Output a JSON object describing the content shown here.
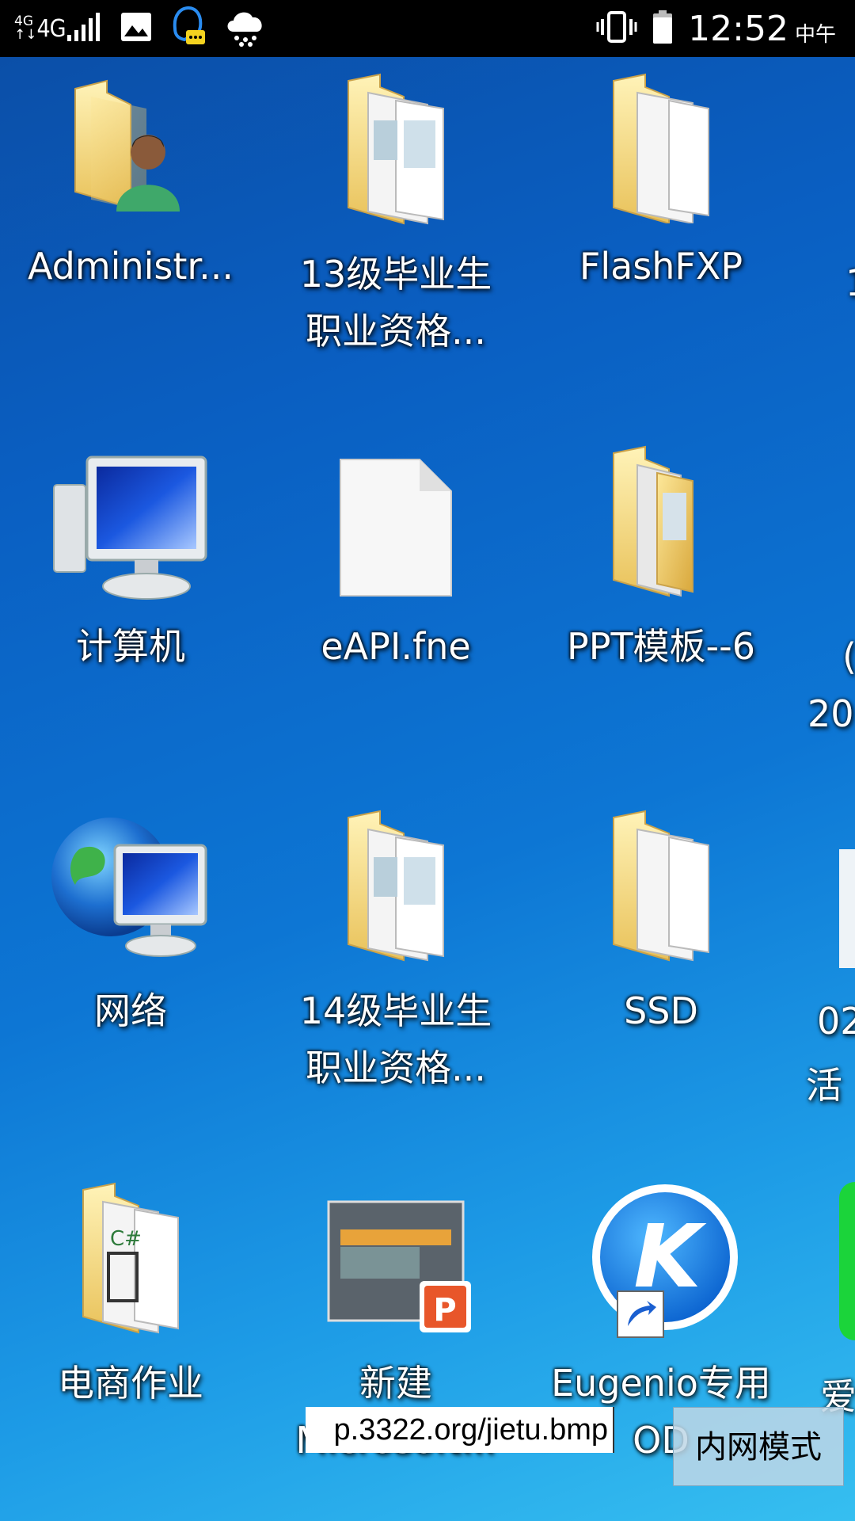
{
  "status_bar": {
    "network_small": [
      "4G",
      "↑↓"
    ],
    "network": "4G",
    "time": "12:52",
    "ampm": "中午"
  },
  "desktop": {
    "icons": [
      {
        "label1": "Administr...",
        "label2": "",
        "icon": "user-folder-icon"
      },
      {
        "label1": "13级毕业生",
        "label2": "职业资格...",
        "icon": "documents-folder-icon"
      },
      {
        "label1": "FlashFXP",
        "label2": "",
        "icon": "folder-icon"
      },
      {
        "label1": "计算机",
        "label2": "",
        "icon": "computer-icon"
      },
      {
        "label1": "eAPI.fne",
        "label2": "",
        "icon": "blank-file-icon"
      },
      {
        "label1": "PPT模板--6",
        "label2": "",
        "icon": "documents-folder-icon"
      },
      {
        "label1": "网络",
        "label2": "",
        "icon": "network-icon"
      },
      {
        "label1": "14级毕业生",
        "label2": "职业资格...",
        "icon": "documents-folder-icon"
      },
      {
        "label1": "SSD",
        "label2": "",
        "icon": "folder-icon"
      },
      {
        "label1": "电商作业",
        "label2": "",
        "icon": "code-folder-icon"
      },
      {
        "label1": "新建",
        "label2": "Microsoft...",
        "icon": "powerpoint-file-icon"
      },
      {
        "label1": "Eugenio专用",
        "label2": "OD",
        "icon": "kugou-shortcut-icon"
      }
    ],
    "partial_labels": [
      "1",
      "(",
      "20",
      "02",
      "活",
      "爱"
    ]
  },
  "url_input": {
    "value": "p.3322.org/jietu.bmp"
  },
  "mode_button": {
    "label": "内网模式"
  }
}
